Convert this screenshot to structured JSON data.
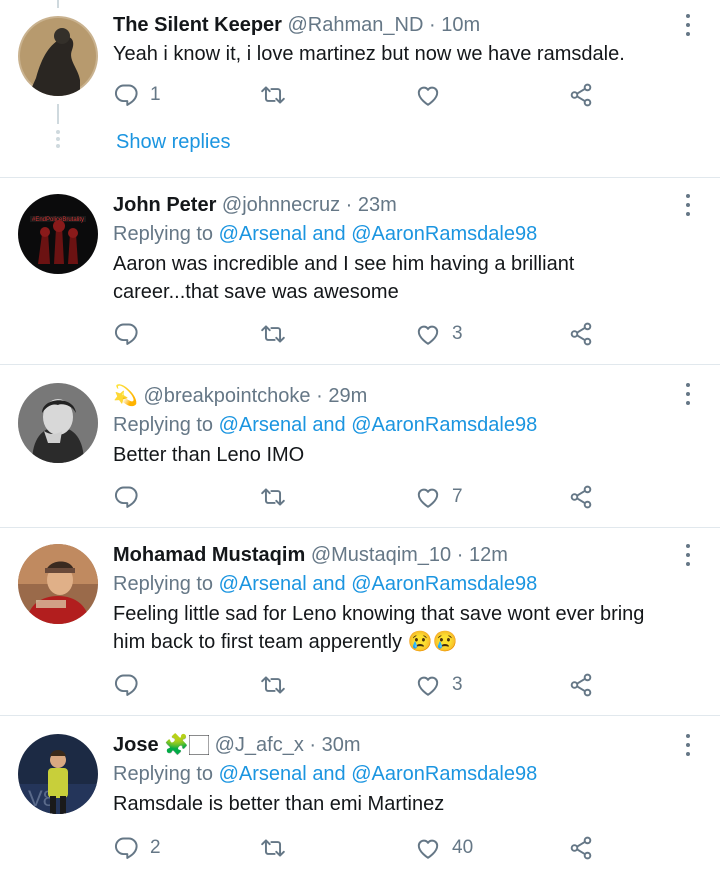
{
  "tweets": [
    {
      "name": "The Silent Keeper",
      "handle": "@Rahman_ND",
      "time": "10m",
      "text": "Yeah i know it, i love martinez but now we have ramsdale.",
      "replies": "1",
      "retweets": "",
      "likes": ""
    },
    {
      "name": "John Peter",
      "handle": "@johnnecruz",
      "time": "23m",
      "replying_label": "Replying to",
      "mention1": "@Arsenal",
      "and_label": "and",
      "mention2": "@AaronRamsdale98",
      "text": "Aaron was incredible and I see him having a brilliant career...that save was awesome",
      "replies": "",
      "retweets": "",
      "likes": "3"
    },
    {
      "name": "💫",
      "handle": "@breakpointchoke",
      "time": "29m",
      "replying_label": "Replying to",
      "mention1": "@Arsenal",
      "and_label": "and",
      "mention2": "@AaronRamsdale98",
      "text": "Better than Leno IMO",
      "replies": "",
      "retweets": "",
      "likes": "7"
    },
    {
      "name": "Mohamad Mustaqim",
      "handle": "@Mustaqim_10",
      "time": "12m",
      "replying_label": "Replying to",
      "mention1": "@Arsenal",
      "and_label": "and",
      "mention2": "@AaronRamsdale98",
      "text": "Feeling little sad for Leno knowing that save wont ever bring him back to first team apperently 😢😢",
      "replies": "",
      "retweets": "",
      "likes": "3"
    },
    {
      "name": "Jose",
      "name_suffix": "🧩🏻",
      "handle": "@J_afc_x",
      "time": "30m",
      "replying_label": "Replying to",
      "mention1": "@Arsenal",
      "and_label": "and",
      "mention2": "@AaronRamsdale98",
      "text": "Ramsdale is better than emi Martinez",
      "replies": "2",
      "retweets": "",
      "likes": "40"
    }
  ],
  "show_replies": "Show replies",
  "separator": "·",
  "icons": {
    "reply": "reply-icon",
    "retweet": "retweet-icon",
    "like": "heart-icon",
    "share": "share-icon",
    "more": "more-vertical-icon"
  },
  "colors": {
    "link": "#1b95e0",
    "muted": "#657786",
    "divider": "#e1e8ed"
  }
}
